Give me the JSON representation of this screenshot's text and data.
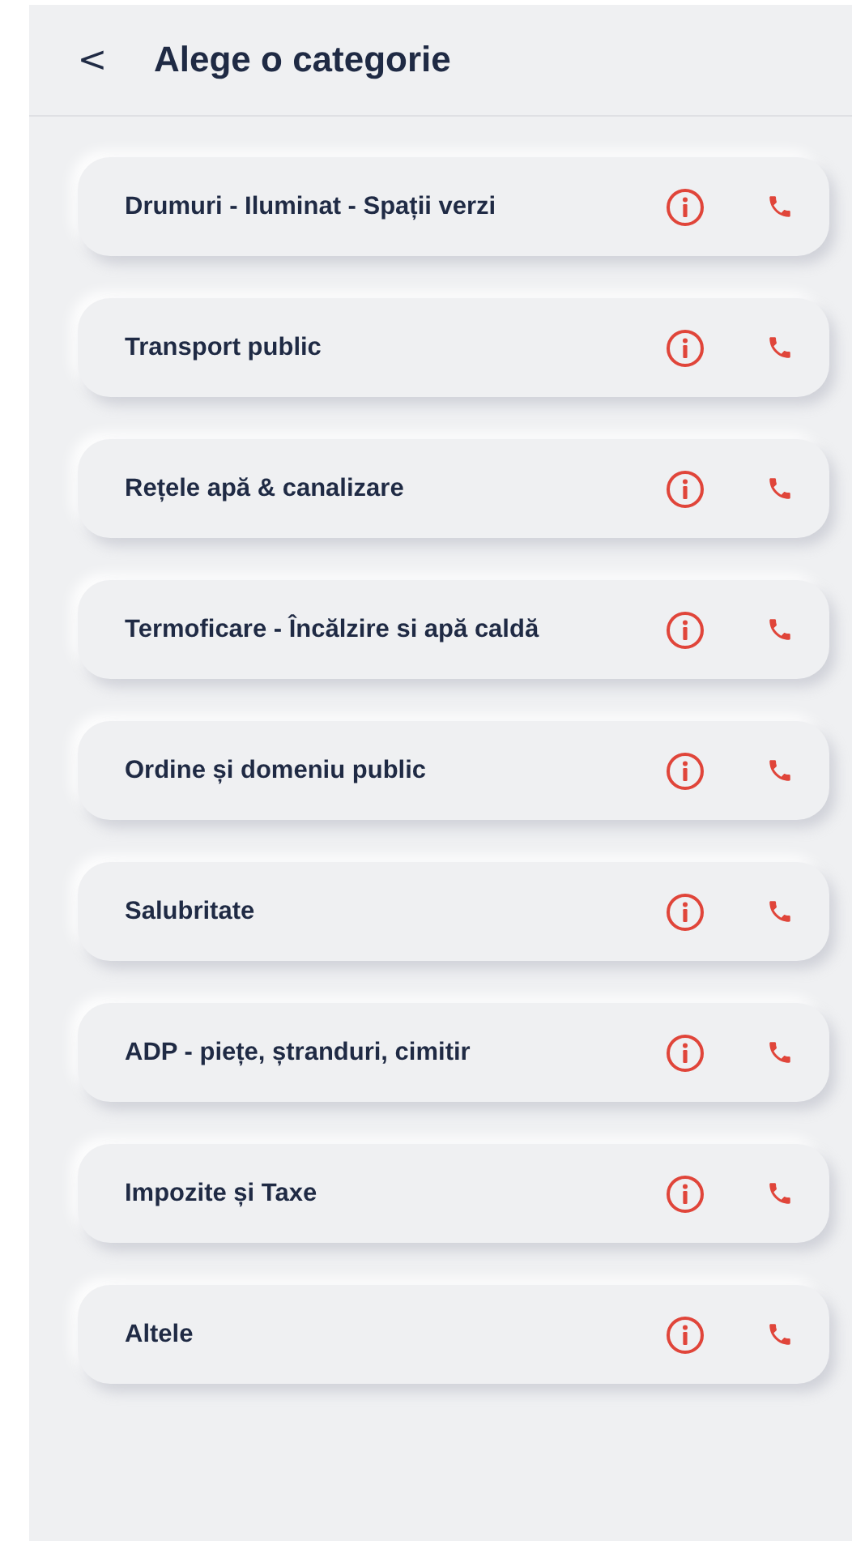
{
  "header": {
    "back": "<",
    "title": "Alege o categorie"
  },
  "categories": [
    {
      "label": "Drumuri - Iluminat - Spații verzi"
    },
    {
      "label": "Transport public"
    },
    {
      "label": "Rețele apă & canalizare"
    },
    {
      "label": "Termoficare - Încălzire si apă caldă"
    },
    {
      "label": "Ordine și domeniu public"
    },
    {
      "label": "Salubritate"
    },
    {
      "label": "ADP - piețe, ștranduri, cimitir"
    },
    {
      "label": "Impozite și Taxe"
    },
    {
      "label": "Altele"
    }
  ]
}
